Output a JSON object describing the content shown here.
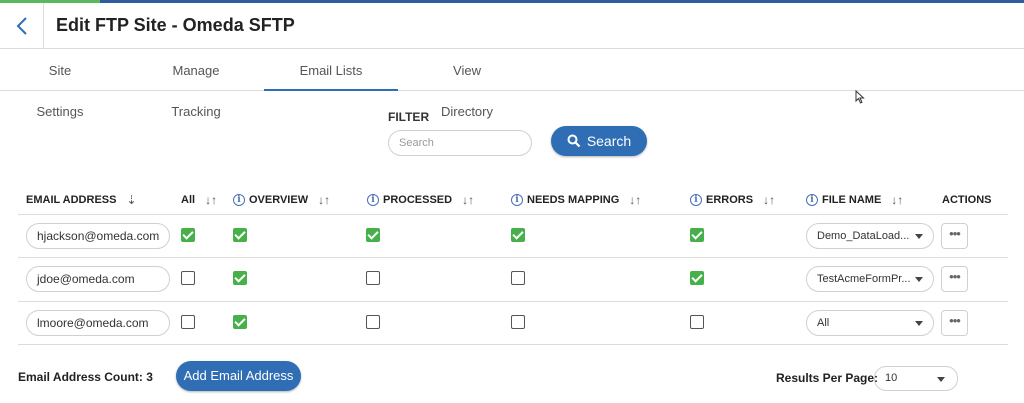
{
  "header": {
    "title": "Edit FTP Site - Omeda SFTP"
  },
  "tabs": [
    {
      "label": "Site Settings"
    },
    {
      "label": "Manage Tracking"
    },
    {
      "label": "Email Lists"
    },
    {
      "label": "View Directory"
    }
  ],
  "active_tab": "Email Lists",
  "filter": {
    "label": "FILTER",
    "placeholder": "Search",
    "button_label": "Search"
  },
  "table": {
    "columns": {
      "email": "EMAIL ADDRESS",
      "all": "All",
      "overview": "OVERVIEW",
      "processed": "PROCESSED",
      "needs_mapping": "NEEDS MAPPING",
      "errors": "ERRORS",
      "file_name": "FILE NAME",
      "actions": "ACTIONS"
    },
    "rows": [
      {
        "email": "hjackson@omeda.com",
        "all": true,
        "overview": true,
        "processed": true,
        "needs_mapping": true,
        "errors": true,
        "file_name": "Demo_DataLoad..."
      },
      {
        "email": "jdoe@omeda.com",
        "all": false,
        "overview": true,
        "processed": false,
        "needs_mapping": false,
        "errors": true,
        "file_name": "TestAcmeFormPr..."
      },
      {
        "email": "lmoore@omeda.com",
        "all": false,
        "overview": true,
        "processed": false,
        "needs_mapping": false,
        "errors": false,
        "file_name": "All"
      }
    ],
    "actions_label": "•••"
  },
  "footer": {
    "count_label": "Email Address Count: 3",
    "add_button": "Add Email Address",
    "results_per_page_label": "Results Per Page:",
    "results_per_page_value": "10"
  },
  "colors": {
    "accent": "#2f6db5",
    "check": "#46b04a"
  },
  "icons": [
    "back-chevron-icon",
    "search-icon",
    "sort-icon",
    "info-icon",
    "caret-down-icon",
    "mouse-cursor-icon"
  ]
}
